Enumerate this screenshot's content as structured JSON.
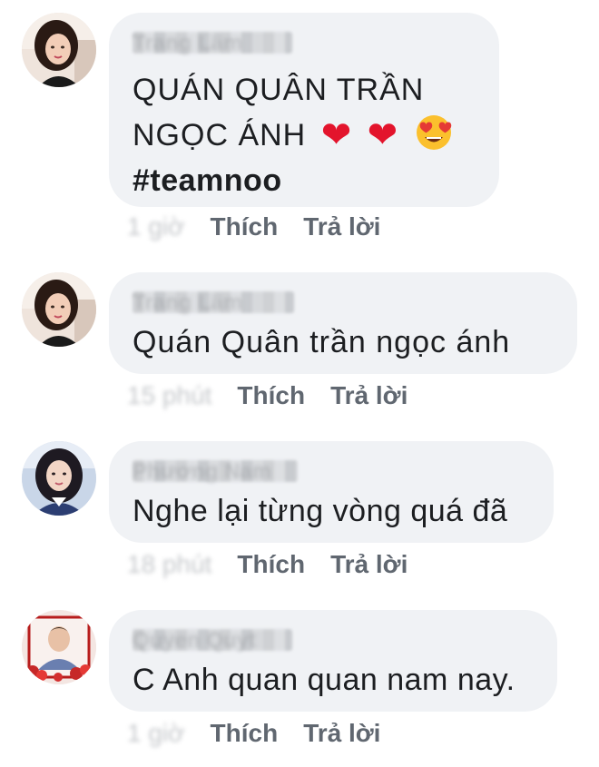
{
  "comments": [
    {
      "author": "Trang Lâm",
      "text_lines": [
        "QUÁN  QUÂN  TRẦN",
        "NGỌC  ÁNH"
      ],
      "emoji": [
        "red-heart",
        "red-heart",
        "heart-eyes-face"
      ],
      "hashtag": "#teamnoo",
      "time": "1 giờ",
      "like_label": "Thích",
      "reply_label": "Trả lời"
    },
    {
      "author": "Trang Lâm",
      "text_lines": [
        "Quán  Quân  trần  ngọc  ánh"
      ],
      "time": "15 phút",
      "like_label": "Thích",
      "reply_label": "Trả lời"
    },
    {
      "author": "Phương Nam",
      "text_lines": [
        "Nghe lại từng vòng quá đã"
      ],
      "time": "18 phút",
      "like_label": "Thích",
      "reply_label": "Trả lời"
    },
    {
      "author": "Quyen Quyt",
      "text_lines": [
        "C Anh quan quan nam nay."
      ],
      "time": "1 giờ",
      "like_label": "Thích",
      "reply_label": "Trả lời"
    }
  ],
  "colors": {
    "bubble": "#f0f2f5",
    "text": "#1c1e21",
    "action": "#606770",
    "heart": "#e3142c"
  }
}
